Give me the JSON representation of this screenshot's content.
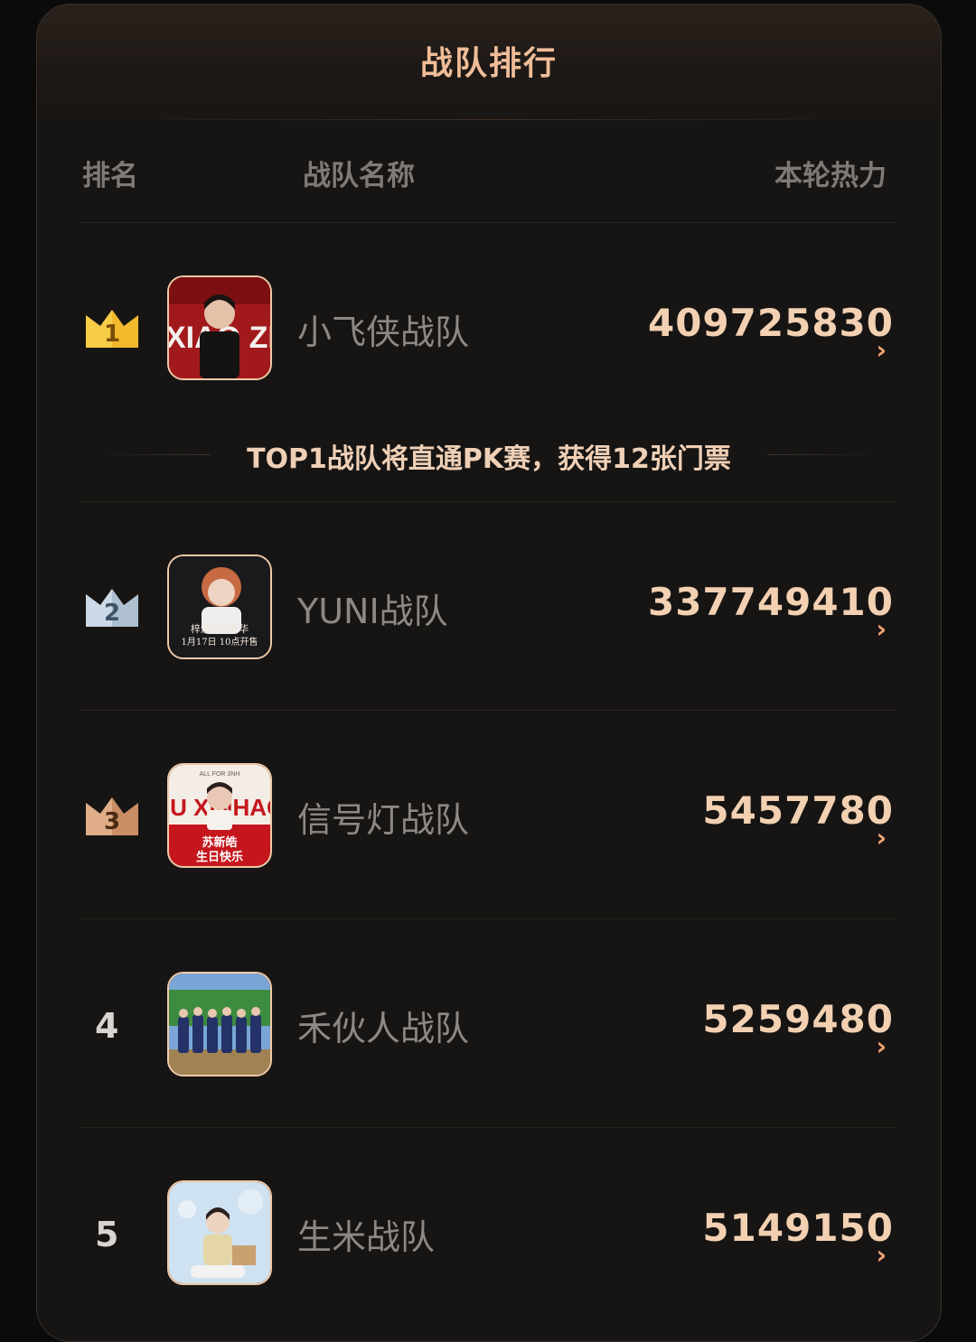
{
  "header": {
    "title": "战队排行"
  },
  "columns": {
    "rank": "排名",
    "name": "战队名称",
    "heat": "本轮热力"
  },
  "notice": "TOP1战队将直通PK赛，获得12张门票",
  "teams": [
    {
      "rank": "1",
      "name": "小飞侠战队",
      "heat": "409725830",
      "badge": "gold-crown"
    },
    {
      "rank": "2",
      "name": "YUNI战队",
      "heat": "337749410",
      "badge": "silver-crown"
    },
    {
      "rank": "3",
      "name": "信号灯战队",
      "heat": "5457780",
      "badge": "bronze-crown"
    },
    {
      "rank": "4",
      "name": "禾伙人战队",
      "heat": "5259480",
      "badge": ""
    },
    {
      "rank": "5",
      "name": "生米战队",
      "heat": "5149150",
      "badge": ""
    }
  ],
  "avatar_texts": {
    "a1": "XIAO ZHAN",
    "a2_line1": "梓渝×施洛华",
    "a2_line2": "1月17日 10点开售",
    "a3_top": "ALL FOR 3NH",
    "a3_big": "SU XINHAO",
    "a3_caption1": "苏新皓",
    "a3_caption2": "生日快乐"
  },
  "chevron_glyph": "›",
  "colors": {
    "title": "#efbd98",
    "heat": "#f2d0b1",
    "chevron": "#f3a774",
    "gold": "#f5c33b",
    "silver": "#c9d6e3",
    "bronze": "#d6a27a"
  }
}
